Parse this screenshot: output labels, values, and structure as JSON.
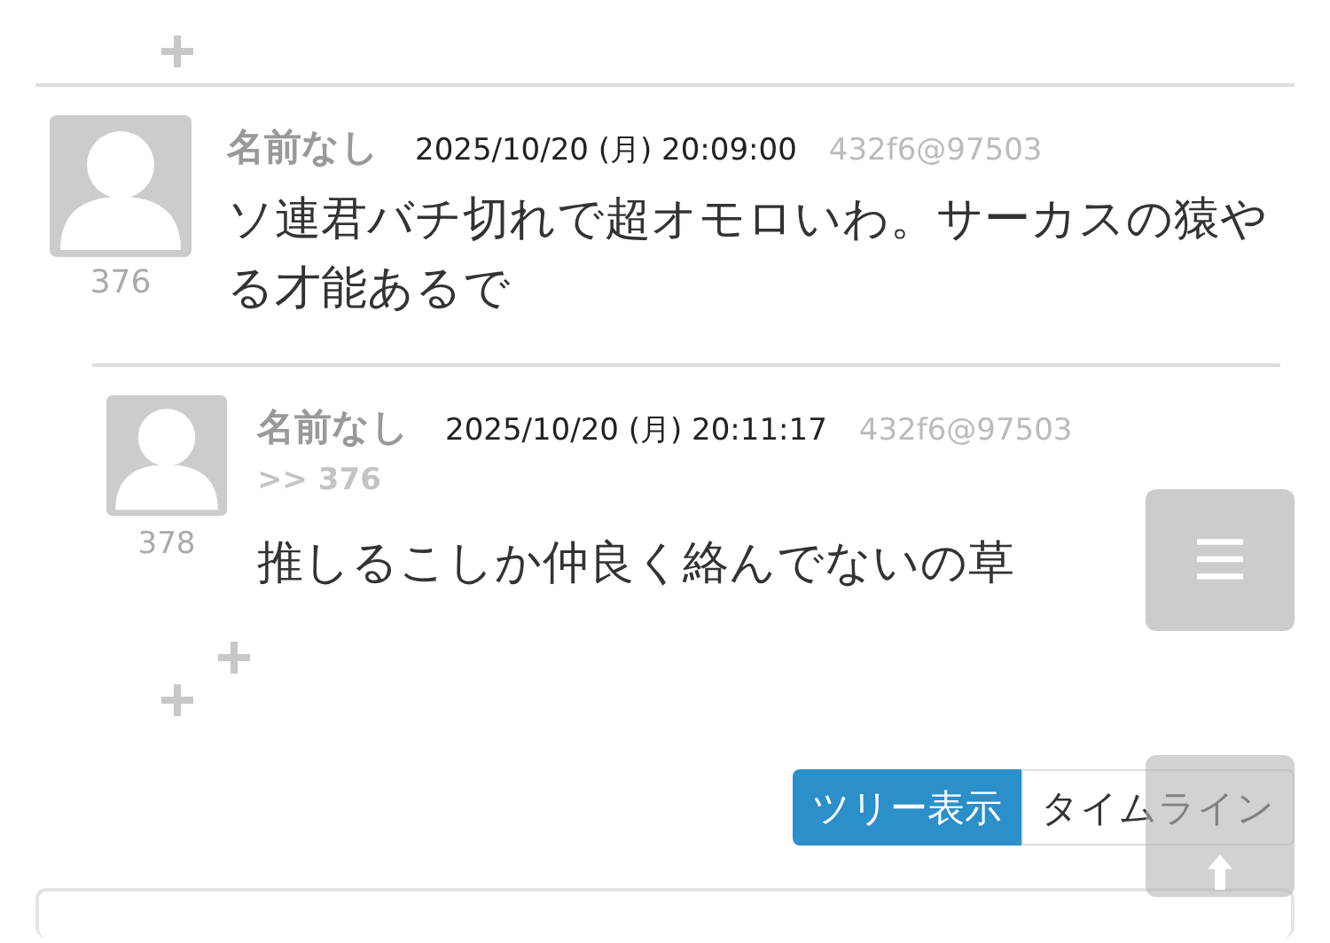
{
  "posts": [
    {
      "name": "名前なし",
      "date": "2025/10/20 (月) 20:09:00",
      "poster_id": "432f6@97503",
      "number": "376",
      "body": "ソ連君バチ切れで超オモロいわ。サーカスの猿やる才能あるで",
      "replies": [
        {
          "name": "名前なし",
          "date": "2025/10/20 (月) 20:11:17",
          "poster_id": "432f6@97503",
          "anchor": ">> 376",
          "number": "378",
          "body": "推しるこしか仲良く絡んでないの草"
        }
      ]
    }
  ],
  "view_toggle": [
    {
      "label": "ツリー表示",
      "selected": true
    },
    {
      "label": "タイムライン",
      "selected": false
    }
  ]
}
